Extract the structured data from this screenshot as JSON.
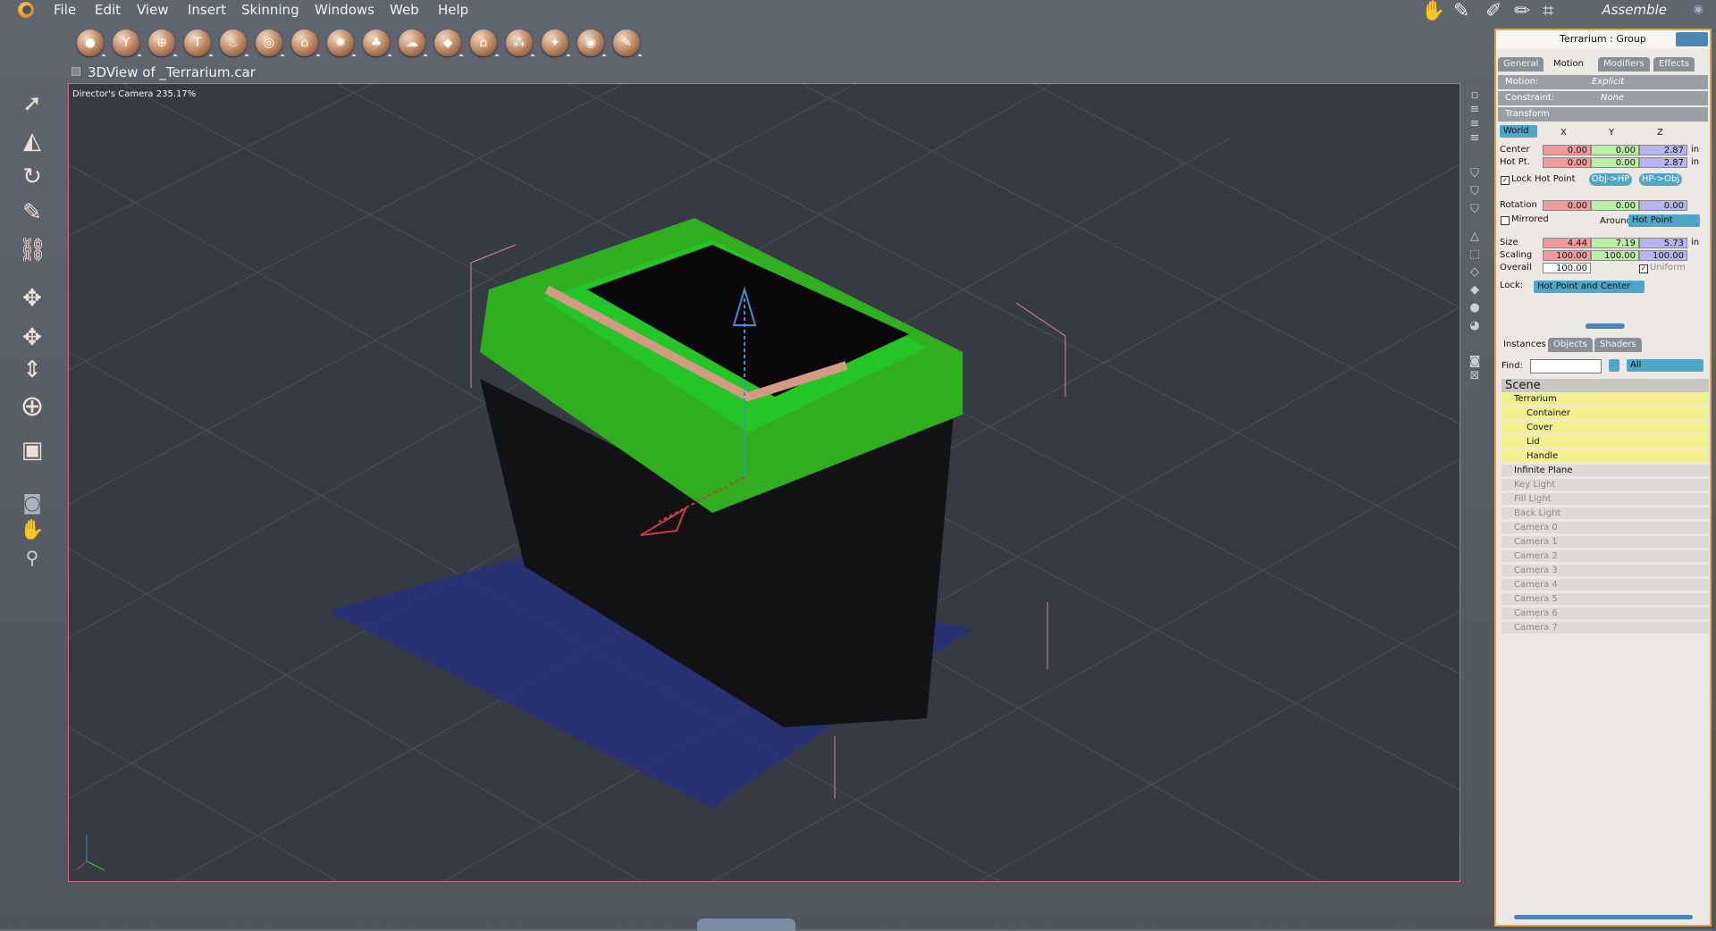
{
  "menu": [
    "File",
    "Edit",
    "View",
    "Insert",
    "Skinning",
    "Windows",
    "Web",
    "Help"
  ],
  "room": "Assemble",
  "toolbar": {
    "tools": [
      "sphere-primitive",
      "glass-primitive",
      "globe-primitive",
      "text-primitive",
      "flame-primitive",
      "torus-primitive",
      "terrain-primitive",
      "plant-primitive",
      "tree-primitive",
      "cloud-primitive",
      "spline-primitive",
      "house-primitive",
      "group-primitive",
      "lights-primitive",
      "target-primitive",
      "brush-primitive"
    ]
  },
  "view": {
    "title": "3DView of _Terrarium.car",
    "camera": "Director's Camera 235.17%"
  },
  "panel": {
    "title": "Terrarium : Group",
    "tabs": [
      "General",
      "Motion",
      "Modifiers",
      "Effects"
    ],
    "active_tab": "Motion",
    "motion_label": "Motion:",
    "motion_value": "Explicit",
    "constraint_label": "Constraint:",
    "constraint_value": "None",
    "transform_label": "Transform",
    "space": "World",
    "col_x": "X",
    "col_y": "Y",
    "col_z": "Z",
    "center_label": "Center",
    "center": [
      "0.00",
      "0.00",
      "2.87"
    ],
    "hotpt_label": "Hot Pt.",
    "hotpt": [
      "0.00",
      "0.00",
      "2.87"
    ],
    "unit": "in",
    "lock_hot_point": "Lock Hot Point",
    "obj_hp": "Obj->HP",
    "hp_obj": "HP->Obj",
    "rotation_label": "Rotation",
    "rotation": [
      "0.00",
      "0.00",
      "0.00"
    ],
    "mirrored": "Mirrored",
    "around_label": "Around",
    "around_value": "Hot Point",
    "size_label": "Size",
    "size": [
      "4.44",
      "7.19",
      "5.73"
    ],
    "scaling_label": "Scaling",
    "scaling": [
      "100.00",
      "100.00",
      "100.00"
    ],
    "overall_label": "Overall",
    "overall": "100.00",
    "uniform": "Uniform",
    "lock_label": "Lock:",
    "lock_value": "Hot Point and Center"
  },
  "browser": {
    "tabs": [
      "Instances",
      "Objects",
      "Shaders"
    ],
    "active_tab": "Instances",
    "find_label": "Find:",
    "filter": "All",
    "scene_header": "Scene",
    "items": [
      {
        "label": "Terrarium",
        "state": "sel",
        "indent": 0
      },
      {
        "label": "Container",
        "state": "sel",
        "indent": 1
      },
      {
        "label": "Cover",
        "state": "sel",
        "indent": 1
      },
      {
        "label": "Lid",
        "state": "sel",
        "indent": 1
      },
      {
        "label": "Handle",
        "state": "sel",
        "indent": 1
      },
      {
        "label": "Infinite Plane",
        "state": "plain",
        "indent": 0
      },
      {
        "label": "Key Light",
        "state": "dim",
        "indent": 0
      },
      {
        "label": "Fill Light",
        "state": "dim",
        "indent": 0
      },
      {
        "label": "Back Light",
        "state": "dim",
        "indent": 0
      },
      {
        "label": "Camera 0",
        "state": "dim",
        "indent": 0
      },
      {
        "label": "Camera 1",
        "state": "dim",
        "indent": 0
      },
      {
        "label": "Camera 2",
        "state": "dim",
        "indent": 0
      },
      {
        "label": "Camera 3",
        "state": "dim",
        "indent": 0
      },
      {
        "label": "Camera 4",
        "state": "dim",
        "indent": 0
      },
      {
        "label": "Camera 5",
        "state": "dim",
        "indent": 0
      },
      {
        "label": "Camera 6",
        "state": "dim",
        "indent": 0
      },
      {
        "label": "Camera 7",
        "state": "dim",
        "indent": 0
      }
    ]
  }
}
